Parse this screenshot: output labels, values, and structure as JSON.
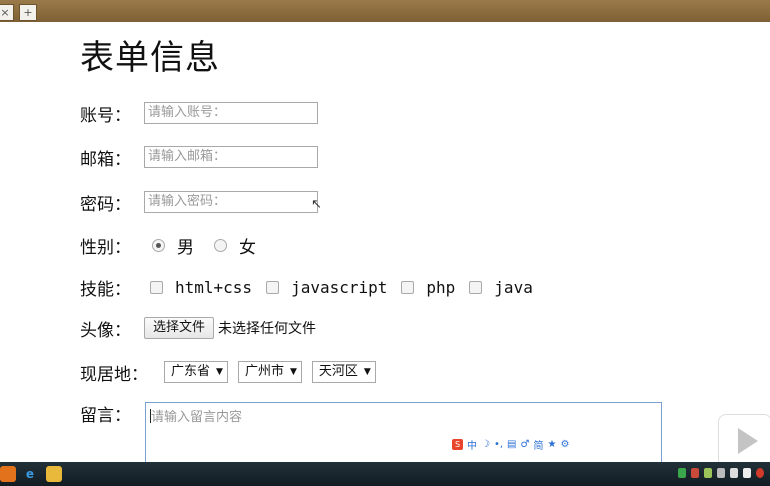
{
  "browser": {
    "tab_close": "×",
    "tab_new": "+"
  },
  "page": {
    "title": "表单信息"
  },
  "form": {
    "account": {
      "label": "账号：",
      "placeholder": "请输入账号："
    },
    "email": {
      "label": "邮箱：",
      "placeholder": "请输入邮箱："
    },
    "password": {
      "label": "密码：",
      "placeholder": "请输入密码："
    },
    "gender": {
      "label": "性别：",
      "options": [
        "男",
        "女"
      ],
      "selected": "男"
    },
    "skills": {
      "label": "技能：",
      "options": [
        "html+css",
        "javascript",
        "php",
        "java"
      ]
    },
    "avatar": {
      "label": "头像：",
      "button": "选择文件",
      "status": "未选择任何文件"
    },
    "location": {
      "label": "现居地：",
      "province": "广东省",
      "city": "广州市",
      "district": "天河区"
    },
    "message": {
      "label": "留言：",
      "placeholder": "请输入留言内容"
    }
  },
  "ime_toolbar": {
    "items": [
      "中",
      "☽",
      "•,",
      "▤",
      "♂",
      "简",
      "★",
      "⚙"
    ]
  },
  "colors": {
    "tabstrip": "#8a6a3c",
    "taskbar": "#1a262d",
    "textarea_focus": "#7aa0cf"
  }
}
